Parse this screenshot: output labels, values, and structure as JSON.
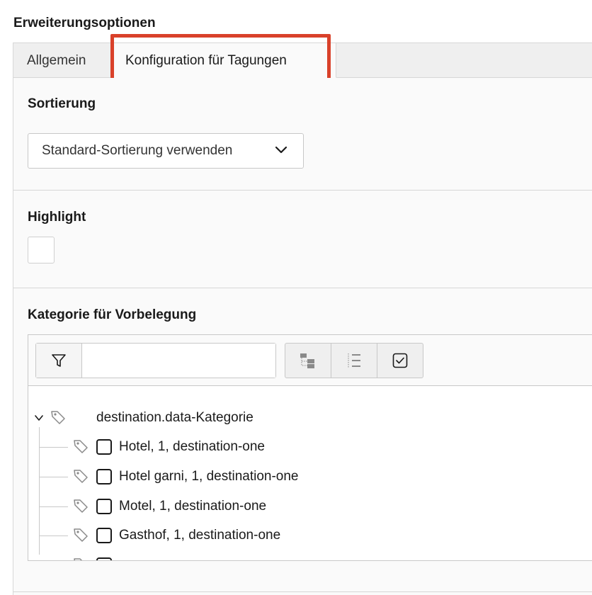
{
  "section": {
    "title": "Erweiterungsoptionen"
  },
  "tabs": [
    {
      "label": "Allgemein",
      "active": false
    },
    {
      "label": "Konfiguration für Tagungen",
      "active": true
    }
  ],
  "annotation": {
    "highlight_color": "#d9412a",
    "target": "tab-konfiguration"
  },
  "sorting": {
    "label": "Sortierung",
    "selected": "Standard-Sortierung verwenden",
    "icon": "chevron-down-icon"
  },
  "highlight": {
    "label": "Highlight",
    "checked": false
  },
  "category": {
    "label": "Kategorie für Vorbelegung",
    "filter": {
      "icon": "filter-icon",
      "value": "",
      "placeholder": ""
    },
    "toolbar": [
      "expand-tree-icon",
      "collapse-tree-icon",
      "toggle-selection-icon"
    ],
    "tree": {
      "root": {
        "label": "destination.data-Kategorie",
        "expanded": true,
        "icon": "tag-icon"
      },
      "items": [
        {
          "label": "Hotel, 1, destination-one",
          "checked": false
        },
        {
          "label": "Hotel garni, 1, destination-one",
          "checked": false
        },
        {
          "label": "Motel, 1, destination-one",
          "checked": false
        },
        {
          "label": "Gasthof, 1, destination-one",
          "checked": false
        }
      ]
    }
  },
  "colors": {
    "border": "#d7d7d7",
    "panel_bg": "#fafafa",
    "tabbar_bg": "#efefef"
  }
}
